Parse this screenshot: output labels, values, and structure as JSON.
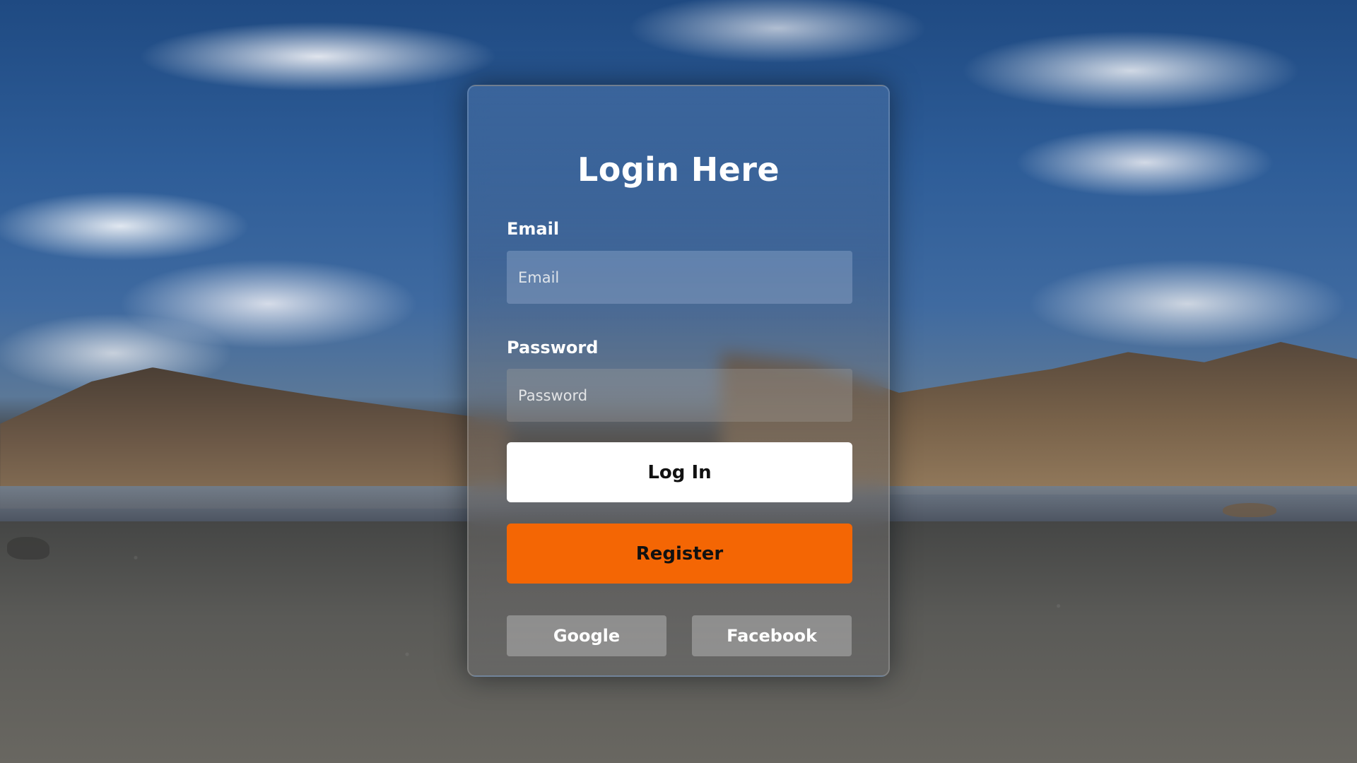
{
  "login": {
    "title": "Login Here",
    "email_label": "Email",
    "email_placeholder": "Email",
    "password_label": "Password",
    "password_placeholder": "Password",
    "login_button": "Log In",
    "register_button": "Register",
    "social": {
      "google": "Google",
      "facebook": "Facebook"
    },
    "colors": {
      "register_accent": "#f46604",
      "login_button_bg": "#ffffff",
      "text": "#ffffff"
    }
  }
}
